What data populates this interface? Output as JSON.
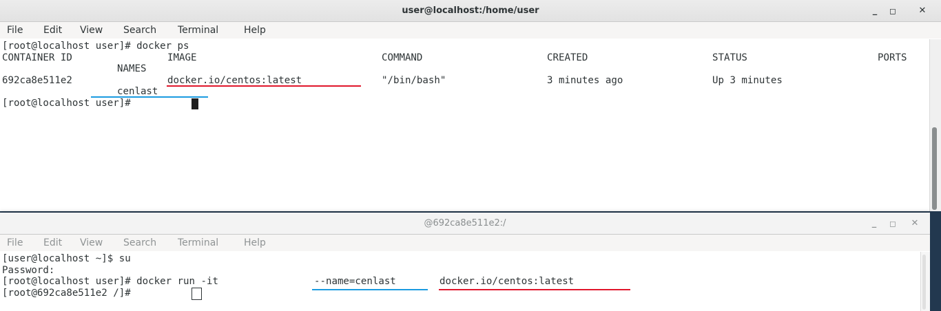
{
  "window1": {
    "title": "user@localhost:/home/user",
    "buttons": {
      "minimize": "_",
      "maximize": "◻",
      "close": "✕"
    },
    "menu": [
      "File",
      "Edit",
      "View",
      "Search",
      "Terminal",
      "Help"
    ],
    "terminal": {
      "prompt1": "[root@localhost user]# docker ps",
      "headers": {
        "container_id": "CONTAINER ID",
        "image": "IMAGE",
        "command": "COMMAND",
        "created": "CREATED",
        "status": "STATUS",
        "ports": "PORTS",
        "names": "NAMES"
      },
      "row": {
        "container_id": "692ca8e511e2",
        "image": "docker.io/centos:latest",
        "command": "\"/bin/bash\"",
        "created": "3 minutes ago",
        "status": "Up 3 minutes",
        "name": "cenlast"
      },
      "prompt2": "[root@localhost user]# "
    }
  },
  "window2": {
    "title": "@692ca8e511e2:/",
    "buttons": {
      "minimize": "_",
      "maximize": "◻",
      "close": "✕"
    },
    "menu": [
      "File",
      "Edit",
      "View",
      "Search",
      "Terminal",
      "Help"
    ],
    "terminal": {
      "line1": "[user@localhost ~]$ su",
      "line2": "Password:",
      "line3_prefix": "[root@localhost user]# docker run -it ",
      "line3_name": "--name=cenlast",
      "line3_image": "docker.io/centos:latest",
      "line4": "[root@692ca8e511e2 /]# "
    }
  },
  "colors": {
    "annotation_red": "#e0162b",
    "annotation_blue": "#1a9be0"
  }
}
